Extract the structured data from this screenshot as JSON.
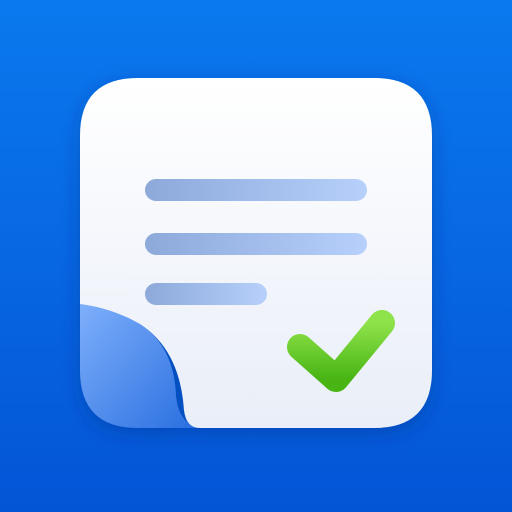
{
  "icon": {
    "name": "notes-checklist-app-icon",
    "colors": {
      "background_top": "#0a79ee",
      "background_bottom": "#0455d6",
      "paper_top": "#ffffff",
      "paper_bottom": "#e9eef8",
      "curl_light": "#7fb0fb",
      "curl_dark": "#2a6fe0",
      "line_left": "#8ca9da",
      "line_right": "#b7d0fb",
      "check_light": "#8ee24a",
      "check_dark": "#48b515"
    },
    "text_lines": 3,
    "checked": true
  }
}
